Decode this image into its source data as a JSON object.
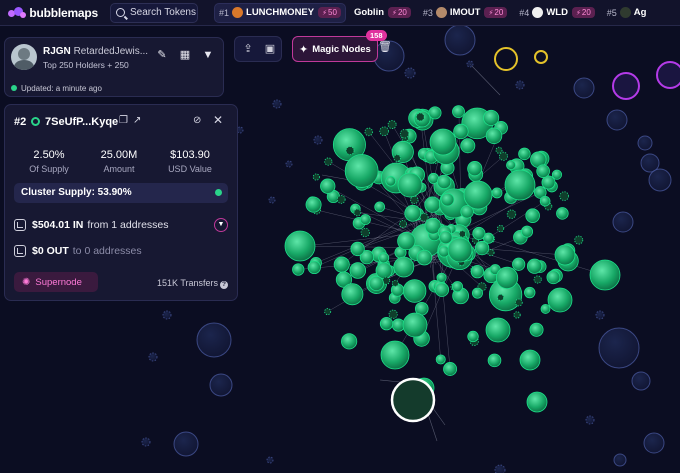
{
  "header": {
    "logo_text": "bubblemaps",
    "search_label": "Search Tokens",
    "tokens": [
      {
        "rank": "#1",
        "name": "LUNCHMONEY",
        "badge": "50",
        "icon_color": "#d9782a",
        "active": true
      },
      {
        "rank": "",
        "name": "Goblin",
        "badge": "20",
        "icon_color": "",
        "active": false
      },
      {
        "rank": "#3",
        "name": "IMOUT",
        "badge": "20",
        "icon_color": "#b48a6a",
        "active": false
      },
      {
        "rank": "#4",
        "name": "WLD",
        "badge": "20",
        "icon_color": "#f0f0f0",
        "active": false
      },
      {
        "rank": "#5",
        "name": "Ag",
        "badge": "",
        "icon_color": "#2f3a2f",
        "active": false
      }
    ]
  },
  "holder": {
    "name": "RJGN",
    "tag": "RetardedJewis...",
    "subtitle": "Top 250 Holders + 250",
    "updated": "Updated: a minute ago"
  },
  "toolbar": {
    "magic_label": "Magic Nodes",
    "magic_count": "158"
  },
  "detail": {
    "rank": "#2",
    "address": "7SeUfP...Kyqe",
    "stats": [
      {
        "value": "2.50%",
        "label": "Of Supply"
      },
      {
        "value": "25.00M",
        "label": "Amount"
      },
      {
        "value": "$103.90",
        "label": "USD Value"
      }
    ],
    "cluster_supply": "Cluster Supply: 53.90%",
    "in_amount": "$504.01 IN",
    "in_text": "from 1 addresses",
    "out_amount": "$0 OUT",
    "out_text": "to 0 addresses",
    "supernode_label": "Supernode",
    "transfers": "151K Transfers"
  },
  "colors": {
    "accent": "#c0399a",
    "node_green": "#2ad48a",
    "node_blue": "#3a4a80",
    "background": "#0b0d22"
  }
}
